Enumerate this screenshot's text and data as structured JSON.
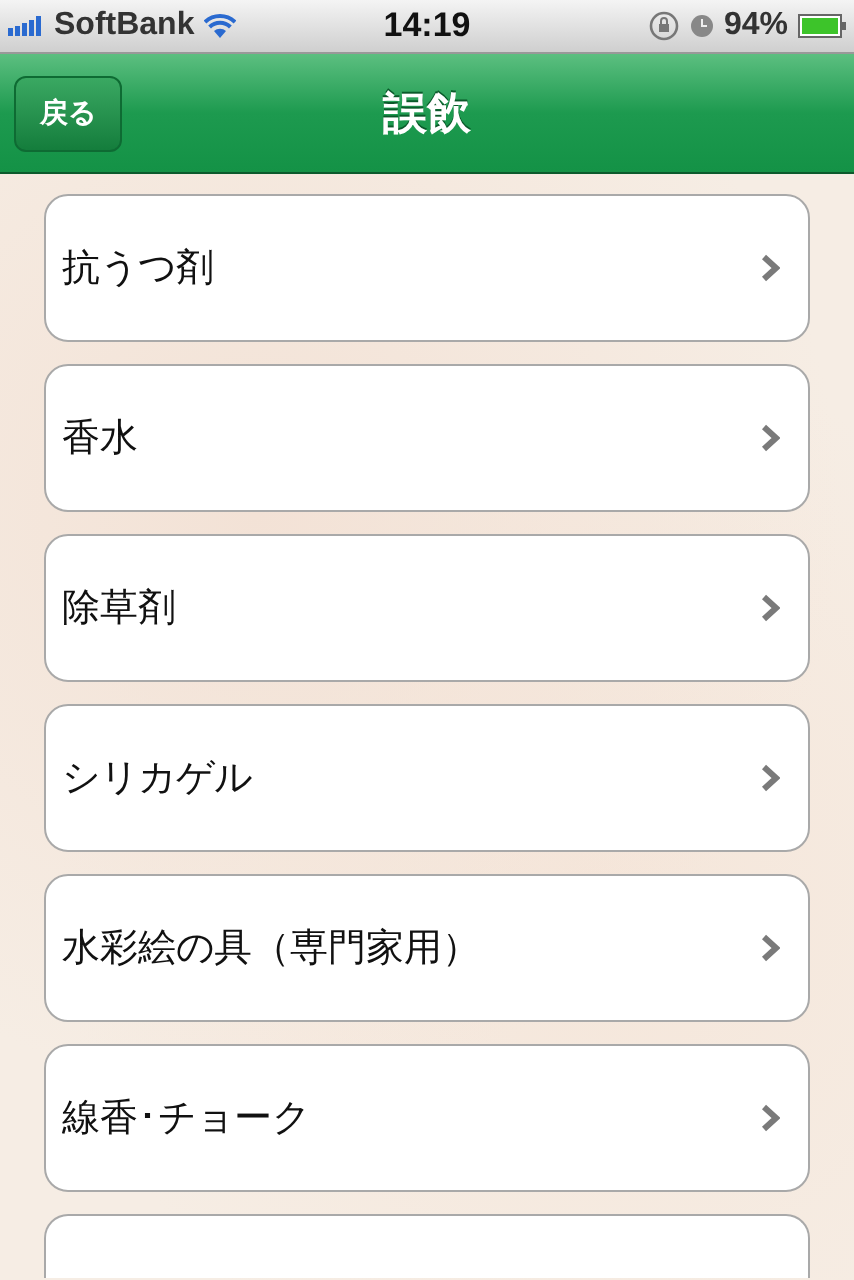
{
  "status_bar": {
    "carrier": "SoftBank",
    "time": "14:19",
    "battery": "94%"
  },
  "nav_bar": {
    "back_button": "戻る",
    "title": "誤飲"
  },
  "items": [
    {
      "kind": "row",
      "label": "抗うつ剤"
    },
    {
      "kind": "row",
      "label": "香水"
    },
    {
      "kind": "row",
      "label": "除草剤"
    },
    {
      "kind": "row",
      "label": "シリカゲル"
    },
    {
      "kind": "row",
      "label": "水彩絵の具（専門家用）"
    },
    {
      "kind": "row",
      "label": "線香･チョーク"
    },
    {
      "kind": "cut_off"
    }
  ]
}
